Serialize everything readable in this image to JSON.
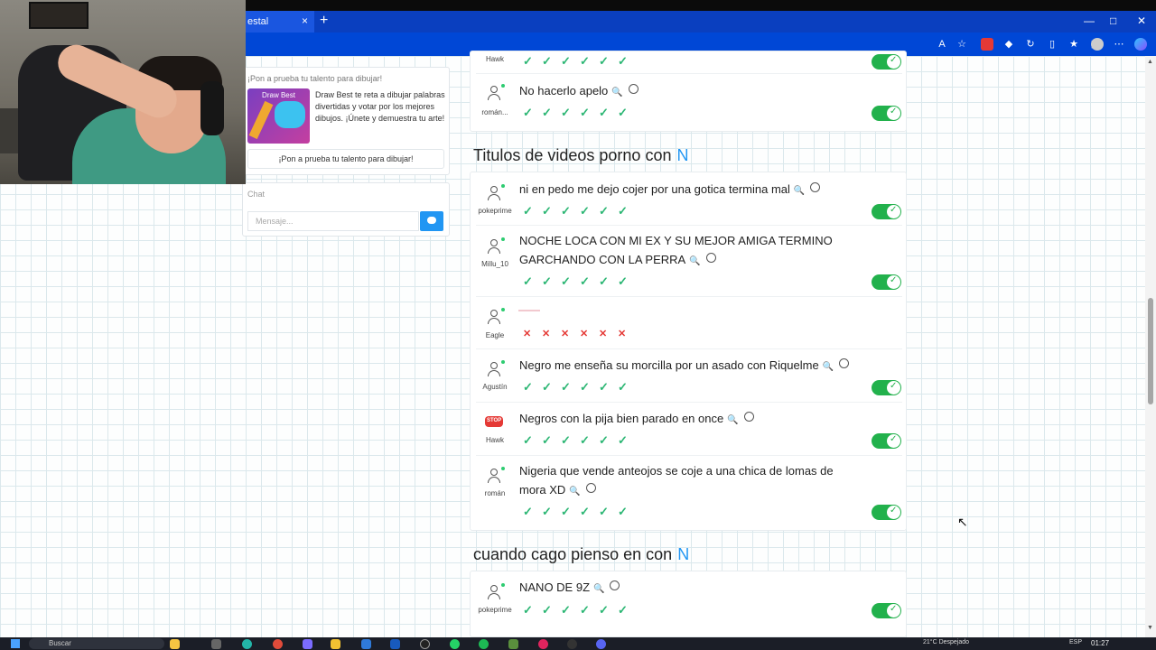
{
  "browser": {
    "tab_title": "estal",
    "tab_close": "×",
    "new_tab": "+",
    "minimize": "—",
    "maximize": "□",
    "close": "✕"
  },
  "sidebar": {
    "promo_title": "¡Pon a prueba tu talento para dibujar!",
    "promo_thumb_label": "Draw Best",
    "promo_desc": "Draw Best te reta a dibujar palabras divertidas y votar por los mejores dibujos. ¡Únete y demuestra tu arte!",
    "promo_button": "¡Pon a prueba tu talento para dibujar!",
    "chat_title": "Chat",
    "chat_placeholder": "Mensaje..."
  },
  "main": {
    "top_card": {
      "rows": [
        {
          "user": "Hawk"
        },
        {
          "user": "román...",
          "answer": "No hacerlo apelo"
        }
      ]
    },
    "categories": [
      {
        "title": "Titulos de videos porno con",
        "letter": "N",
        "rows": [
          {
            "user": "pokeprime",
            "answer": "ni en pedo me dejo cojer por una gotica termina mal",
            "valid": true
          },
          {
            "user": "Millu_10",
            "answer": "NOCHE LOCA CON MI EX Y SU MEJOR AMIGA TERMINO GARCHANDO CON LA PERRA",
            "valid": true
          },
          {
            "user": "Eagle",
            "answer": "",
            "valid": false
          },
          {
            "user": "Agustín",
            "answer": "Negro me enseña su morcilla por un asado con Riquelme",
            "valid": true
          },
          {
            "user": "Hawk",
            "answer": "Negros con la pija bien parado en once",
            "valid": true,
            "avatar": "stop"
          },
          {
            "user": "román",
            "answer": "Nigeria que vende anteojos se coje a una chica de lomas de mora XD",
            "valid": true
          }
        ]
      },
      {
        "title": "cuando cago pienso en con",
        "letter": "N",
        "rows": [
          {
            "user": "pokeprime",
            "answer": "NANO DE 9Z",
            "valid": true
          }
        ]
      }
    ]
  },
  "icons": {
    "check": "✓",
    "cross": "✕",
    "search": "🔍",
    "stop_label": "STOP"
  },
  "taskbar": {
    "search_placeholder": "Buscar",
    "clock": "01:27",
    "weather": "21°C  Despejado",
    "lang": "ESP"
  },
  "colors": {
    "accent": "#2196f3",
    "toggle_on": "#22b14c",
    "check": "#2bb673",
    "cross": "#e53935",
    "browser_blue": "#0047d6"
  }
}
